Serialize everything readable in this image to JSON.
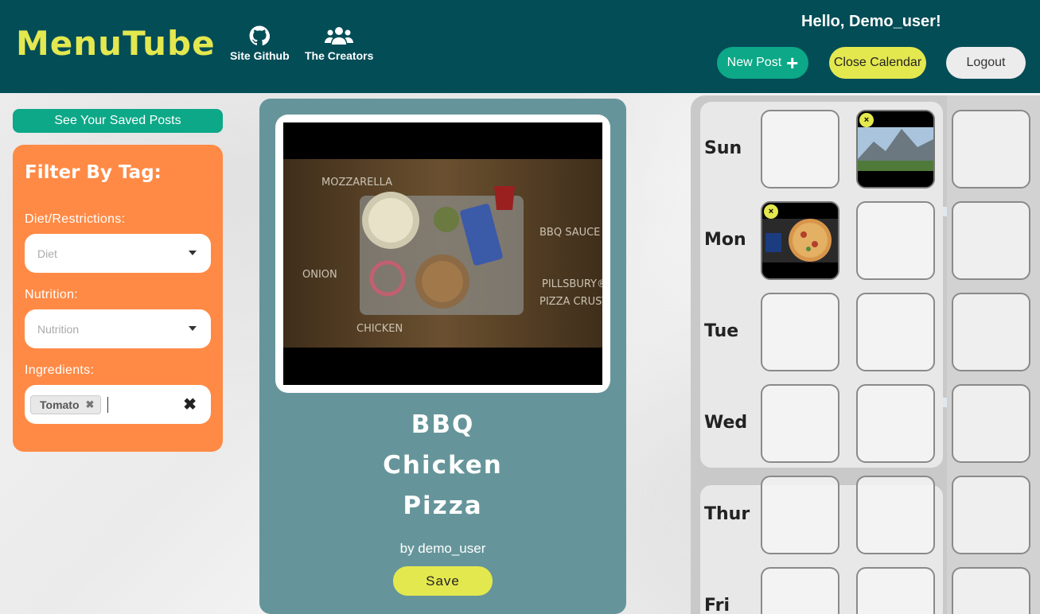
{
  "header": {
    "logo": "MenuTube",
    "nav": [
      {
        "label": "Site Github",
        "icon": "github-icon"
      },
      {
        "label": "The Creators",
        "icon": "users-icon"
      }
    ],
    "greeting": "Hello, Demo_user!",
    "new_post_label": "New Post",
    "close_calendar_label": "Close Calendar",
    "logout_label": "Logout"
  },
  "sidebar": {
    "saved_posts_label": "See Your Saved Posts",
    "filter_title": "Filter By Tag:",
    "diet_label": "Diet/Restrictions:",
    "diet_placeholder": "Diet",
    "nutrition_label": "Nutrition:",
    "nutrition_placeholder": "Nutrition",
    "ingredients_label": "Ingredients:",
    "ingredient_tags": [
      "Tomato"
    ]
  },
  "post": {
    "title_lines": [
      "BBQ",
      "Chicken",
      "Pizza"
    ],
    "byline": "by demo_user",
    "save_label": "Save",
    "video_labels": {
      "mozzarella": "MOZZARELLA",
      "bbq_sauce": "BBQ SAUCE",
      "onion": "ONION",
      "crust_line1": "PILLSBURY®",
      "crust_line2": "PIZZA CRUST",
      "chicken": "CHICKEN"
    }
  },
  "calendar": {
    "days": [
      "Sun",
      "Mon",
      "Tue",
      "Wed",
      "Thur",
      "Fri"
    ],
    "filled_slots": [
      {
        "day": "Sun",
        "slot": 2,
        "thumbnail": "mountain-landscape"
      },
      {
        "day": "Mon",
        "slot": 1,
        "thumbnail": "pizza-box"
      }
    ],
    "remove_glyph": "×"
  },
  "colors": {
    "header_bg": "#034d57",
    "accent_yellow": "#e4e84f",
    "accent_green": "#0ca887",
    "filter_orange": "#ff8a45",
    "post_card": "#65959a"
  }
}
